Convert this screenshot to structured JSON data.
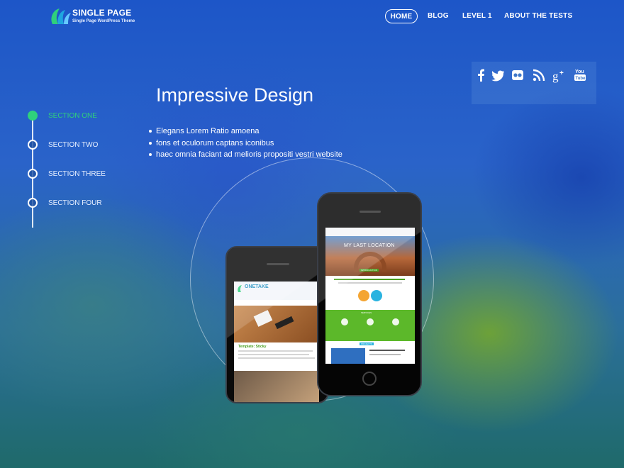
{
  "brand": {
    "title": "SINGLE PAGE",
    "subtitle": "Single Page WordPress Theme",
    "logo_icon": "swirl-logo-icon"
  },
  "nav": {
    "items": [
      {
        "label": "HOME",
        "active": true
      },
      {
        "label": "BLOG"
      },
      {
        "label": "LEVEL 1"
      },
      {
        "label": "ABOUT THE TESTS"
      }
    ]
  },
  "social": {
    "icons": [
      "facebook-icon",
      "twitter-icon",
      "flickr-icon",
      "rss-icon",
      "google-plus-icon",
      "youtube-icon"
    ]
  },
  "sections": {
    "items": [
      {
        "label": "SECTION ONE",
        "active": true
      },
      {
        "label": "SECTION TWO"
      },
      {
        "label": "SECTION THREE"
      },
      {
        "label": "SECTION FOUR"
      }
    ]
  },
  "content": {
    "heading": "Impressive Design",
    "bullets": [
      "Elegans Lorem Ratio amoena",
      "fons et oculorum captans iconibus",
      "haec omnia faciant ad melioris propositi vestri website"
    ]
  },
  "phone_back": {
    "brand": "ONETAKE",
    "post_title": "Template: Sticky"
  },
  "phone_front": {
    "hero": "MY LAST LOCATION",
    "intro_label": "INTRODUCTION",
    "services_label": "SERVICES",
    "projects_label": "PROJECTS"
  },
  "colors": {
    "accent": "#2fd07c",
    "green_band": "#5cb82a"
  }
}
